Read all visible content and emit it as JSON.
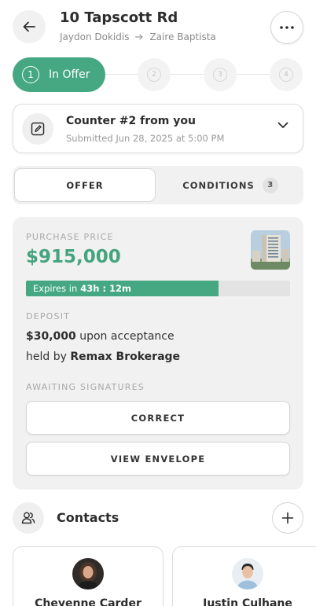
{
  "header": {
    "title": "10 Tapscott Rd",
    "from_party": "Jaydon Dokidis",
    "to_party": "Zaire Baptista",
    "back_icon": "arrow-left-icon",
    "more_icon": "more-horizontal-icon"
  },
  "stepper": {
    "active_number": "1",
    "active_label": "In Offer",
    "steps": [
      "2",
      "3",
      "4"
    ]
  },
  "counter": {
    "title": "Counter #2 from you",
    "subtitle": "Submitted Jun 28, 2025 at 5:00 PM"
  },
  "tabs": {
    "offer_label": "OFFER",
    "conditions_label": "CONDITIONS",
    "conditions_count": "3"
  },
  "offer": {
    "price_label": "PURCHASE PRICE",
    "price": "$915,000",
    "expires_label": "Expires in",
    "expires_value": "43h : 12m",
    "expiry_progress": 0.73,
    "deposit_label": "DEPOSIT",
    "deposit_amount": "$30,000",
    "deposit_terms": "upon acceptance",
    "held_by_prefix": "held by",
    "held_by": "Remax Brokerage",
    "signatures_label": "AWAITING SIGNATURES",
    "correct_button": "CORRECT",
    "view_envelope_button": "VIEW ENVELOPE"
  },
  "contacts": {
    "title": "Contacts",
    "people": [
      {
        "name": "Cheyenne Carder"
      },
      {
        "name": "Justin Culhane"
      }
    ]
  },
  "colors": {
    "accent": "#45a882",
    "price": "#43a47e"
  }
}
